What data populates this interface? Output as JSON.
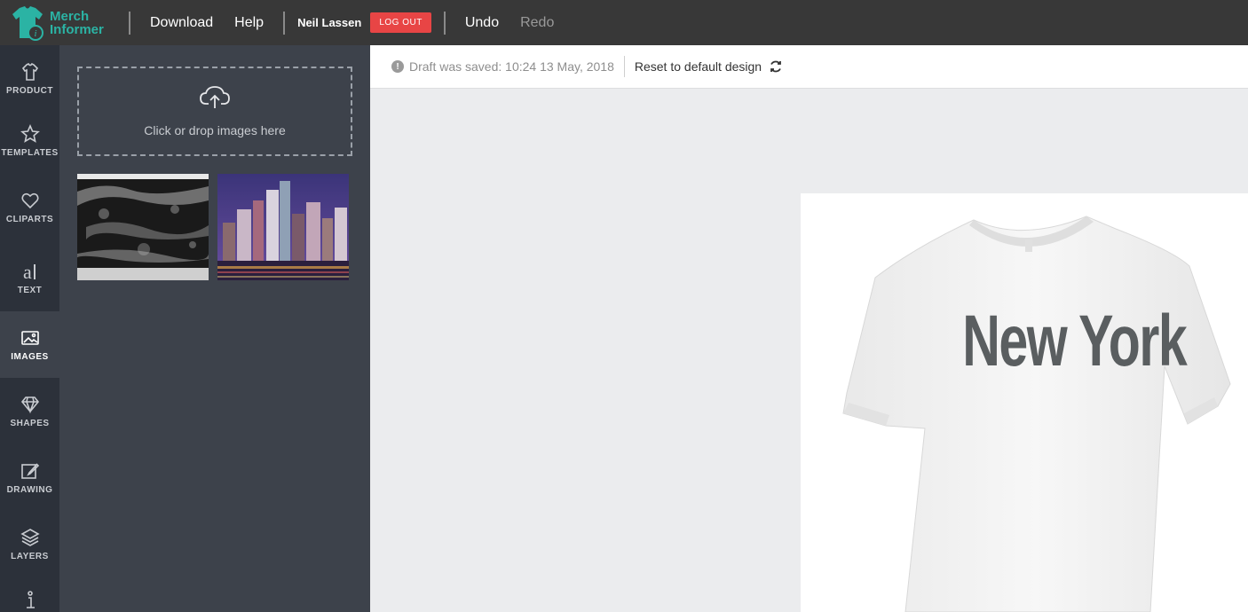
{
  "header": {
    "logo_line1": "Merch",
    "logo_line2": "Informer",
    "download_label": "Download",
    "help_label": "Help",
    "user_name": "Neil Lassen",
    "logout_label": "LOG OUT",
    "undo_label": "Undo",
    "redo_label": "Redo"
  },
  "sidebar": {
    "items": [
      {
        "label": "PRODUCT",
        "icon": "shirt-icon"
      },
      {
        "label": "TEMPLATES",
        "icon": "star-icon"
      },
      {
        "label": "CLIPARTS",
        "icon": "heart-icon"
      },
      {
        "label": "TEXT",
        "icon": "text-icon"
      },
      {
        "label": "IMAGES",
        "icon": "image-icon",
        "active": true
      },
      {
        "label": "SHAPES",
        "icon": "diamond-icon"
      },
      {
        "label": "DRAWING",
        "icon": "pencil-icon"
      },
      {
        "label": "LAYERS",
        "icon": "layers-icon"
      }
    ]
  },
  "images_panel": {
    "dropzone_text": "Click or drop images here",
    "thumbnails": [
      "grunge-texture-image",
      "city-skyline-image"
    ]
  },
  "status": {
    "draft_text": "Draft was saved: 10:24 13 May, 2018",
    "reset_label": "Reset to default design"
  },
  "design": {
    "text": "New York",
    "text_color": "#5a5e60",
    "shirt_color": "#ffffff"
  },
  "colors": {
    "accent": "#2bb3a4",
    "logout": "#e84545",
    "topbar": "#383838"
  }
}
